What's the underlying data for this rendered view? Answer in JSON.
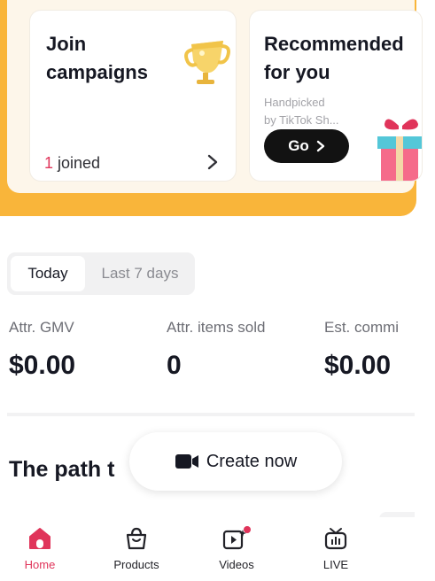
{
  "promo": {
    "join": {
      "title": "Join\ncampaigns",
      "joined_count": "1",
      "joined_suffix": " joined"
    },
    "recommended": {
      "title": "Recommended\nfor you",
      "subtitle": "Handpicked\nby TikTok Sh...",
      "button_label": "Go"
    }
  },
  "period_tabs": [
    "Today",
    "Last 7 days"
  ],
  "selected_tab": "Today",
  "metrics": [
    {
      "label": "Attr. GMV",
      "value": "$0.00"
    },
    {
      "label": "Attr. items sold",
      "value": "0"
    },
    {
      "label": "Est. commi",
      "value": "$0.00"
    }
  ],
  "path_title": "The path t",
  "create_label": "Create now",
  "nav": {
    "items": [
      {
        "label": "Home",
        "icon": "home-icon",
        "active": true
      },
      {
        "label": "Products",
        "icon": "shopping-bag-icon",
        "active": false
      },
      {
        "label": "Videos",
        "icon": "video-sparkle-icon",
        "active": false
      },
      {
        "label": "LIVE",
        "icon": "live-tv-icon",
        "active": false
      }
    ]
  },
  "colors": {
    "accent": "#e0345a",
    "band": "#f9b53a",
    "go_button": "#121212"
  }
}
